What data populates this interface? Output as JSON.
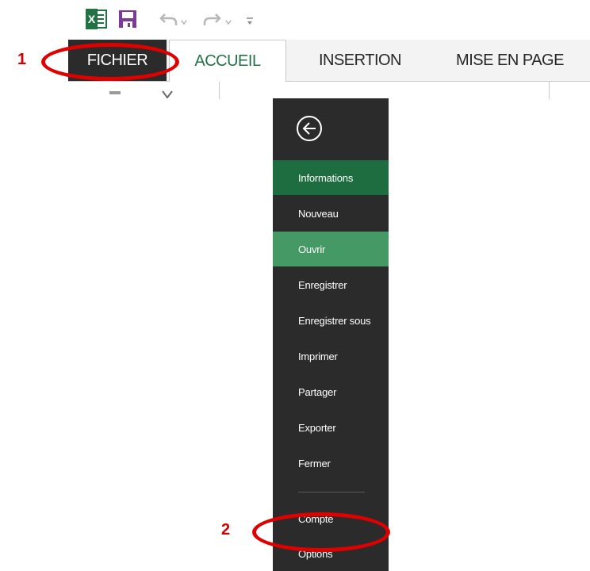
{
  "quick_access": {
    "icons": [
      "excel-icon",
      "save-icon",
      "undo-icon",
      "redo-icon",
      "customize-icon"
    ],
    "excel_glyph": "X",
    "colors": {
      "excel_green": "#217346",
      "save_purple": "#7b3a99",
      "undo_gray": "#b7b7b7"
    }
  },
  "ribbon": {
    "tabs": [
      "FICHIER",
      "ACCUEIL",
      "INSERTION",
      "MISE EN PAGE"
    ]
  },
  "backstage": {
    "items": [
      "Informations",
      "Nouveau",
      "Ouvrir",
      "Enregistrer",
      "Enregistrer sous",
      "Imprimer",
      "Partager",
      "Exporter",
      "Fermer",
      "Compte",
      "Options"
    ],
    "selected": "Informations",
    "hovered": "Ouvrir",
    "colors": {
      "background": "#2b2b2b",
      "selected": "#1e6d40",
      "hover": "#459965"
    }
  },
  "annotations": {
    "step1": "1",
    "step2": "2",
    "color": "#e00000"
  }
}
